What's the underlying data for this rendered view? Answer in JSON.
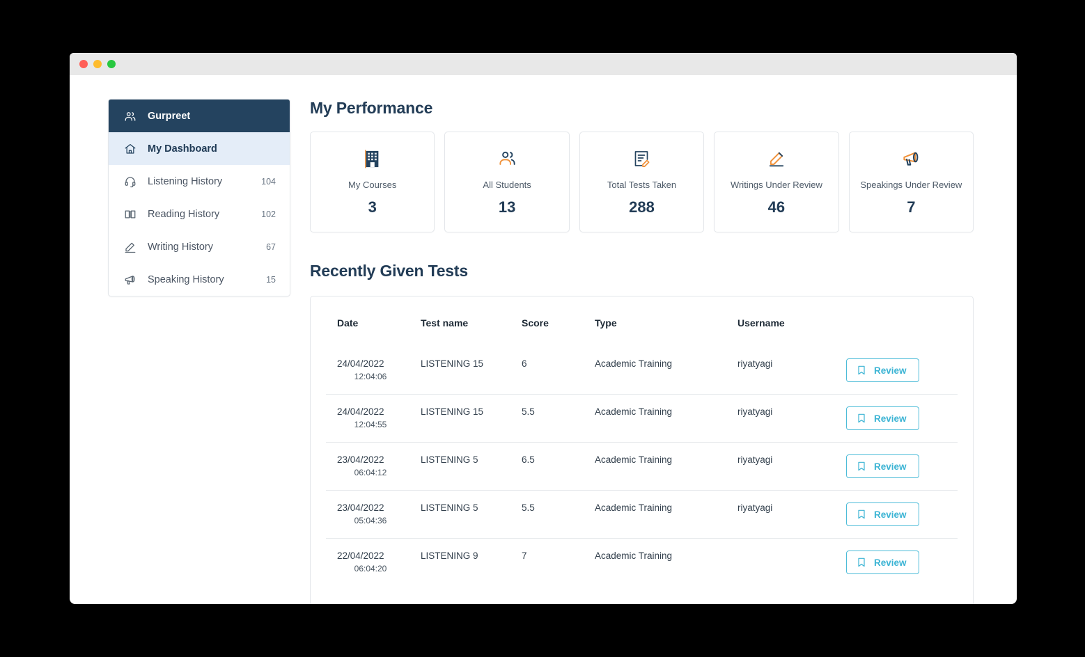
{
  "window": {
    "traffic_lights": [
      "close",
      "minimize",
      "maximize"
    ]
  },
  "sidebar": {
    "header": {
      "label": "Gurpreet",
      "icon": "users-icon"
    },
    "items": [
      {
        "label": "My Dashboard",
        "count": "",
        "icon": "home-icon",
        "active": true
      },
      {
        "label": "Listening History",
        "count": "104",
        "icon": "headphones-icon",
        "active": false
      },
      {
        "label": "Reading History",
        "count": "102",
        "icon": "book-icon",
        "active": false
      },
      {
        "label": "Writing History",
        "count": "67",
        "icon": "pencil-icon",
        "active": false
      },
      {
        "label": "Speaking History",
        "count": "15",
        "icon": "megaphone-icon",
        "active": false
      }
    ]
  },
  "main": {
    "performance_title": "My Performance",
    "stats": [
      {
        "label": "My Courses",
        "value": "3",
        "icon": "building-icon"
      },
      {
        "label": "All Students",
        "value": "13",
        "icon": "users-icon"
      },
      {
        "label": "Total Tests Taken",
        "value": "288",
        "icon": "document-edit-icon"
      },
      {
        "label": "Writings Under Review",
        "value": "46",
        "icon": "pencil-icon"
      },
      {
        "label": "Speakings Under Review",
        "value": "7",
        "icon": "megaphone-icon"
      }
    ],
    "tests_title": "Recently Given Tests",
    "table": {
      "columns": [
        "Date",
        "Test name",
        "Score",
        "Type",
        "Username",
        ""
      ],
      "action_label": "Review",
      "action_icon": "bookmark-icon",
      "rows": [
        {
          "date": "24/04/2022",
          "time": "12:04:06",
          "test": "LISTENING 15",
          "score": "6",
          "type": "Academic Training",
          "username": "riyatyagi",
          "action": "Review"
        },
        {
          "date": "24/04/2022",
          "time": "12:04:55",
          "test": "LISTENING 15",
          "score": "5.5",
          "type": "Academic Training",
          "username": "riyatyagi",
          "action": "Review"
        },
        {
          "date": "23/04/2022",
          "time": "06:04:12",
          "test": "LISTENING 5",
          "score": "6.5",
          "type": "Academic Training",
          "username": "riyatyagi",
          "action": "Review"
        },
        {
          "date": "23/04/2022",
          "time": "05:04:36",
          "test": "LISTENING 5",
          "score": "5.5",
          "type": "Academic Training",
          "username": "riyatyagi",
          "action": "Review"
        },
        {
          "date": "22/04/2022",
          "time": "06:04:20",
          "test": "LISTENING 9",
          "score": "7",
          "type": "Academic Training",
          "username": "",
          "action": "Review"
        }
      ]
    }
  },
  "colors": {
    "sidebar_header_bg": "#24435f",
    "active_item_bg": "#e4edf8",
    "heading": "#223c56",
    "accent_cyan": "#3cb4d4",
    "icon_navy": "#24435f",
    "icon_orange": "#f0913a"
  }
}
